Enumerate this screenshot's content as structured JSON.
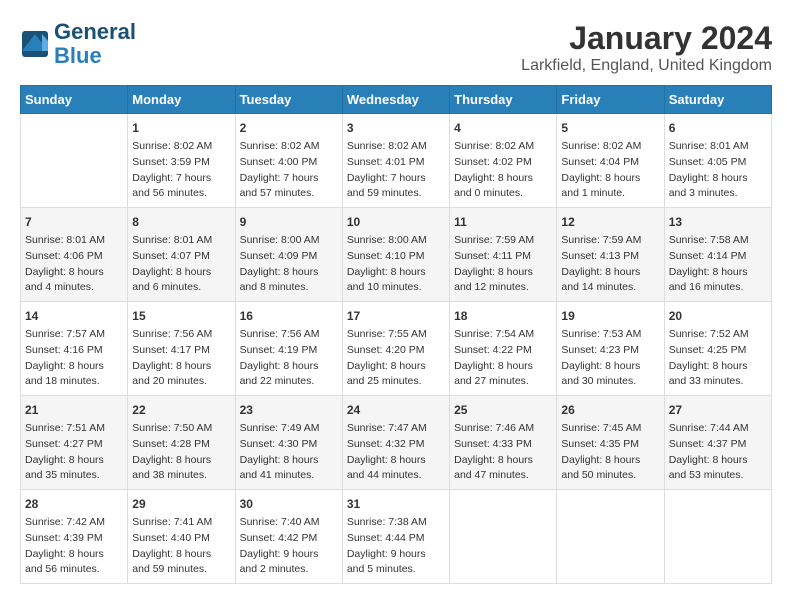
{
  "header": {
    "logo_line1": "General",
    "logo_line2": "Blue",
    "title": "January 2024",
    "subtitle": "Larkfield, England, United Kingdom"
  },
  "days_of_week": [
    "Sunday",
    "Monday",
    "Tuesday",
    "Wednesday",
    "Thursday",
    "Friday",
    "Saturday"
  ],
  "weeks": [
    [
      {
        "day": "",
        "content": ""
      },
      {
        "day": "1",
        "content": "Sunrise: 8:02 AM\nSunset: 3:59 PM\nDaylight: 7 hours\nand 56 minutes."
      },
      {
        "day": "2",
        "content": "Sunrise: 8:02 AM\nSunset: 4:00 PM\nDaylight: 7 hours\nand 57 minutes."
      },
      {
        "day": "3",
        "content": "Sunrise: 8:02 AM\nSunset: 4:01 PM\nDaylight: 7 hours\nand 59 minutes."
      },
      {
        "day": "4",
        "content": "Sunrise: 8:02 AM\nSunset: 4:02 PM\nDaylight: 8 hours\nand 0 minutes."
      },
      {
        "day": "5",
        "content": "Sunrise: 8:02 AM\nSunset: 4:04 PM\nDaylight: 8 hours\nand 1 minute."
      },
      {
        "day": "6",
        "content": "Sunrise: 8:01 AM\nSunset: 4:05 PM\nDaylight: 8 hours\nand 3 minutes."
      }
    ],
    [
      {
        "day": "7",
        "content": "Sunrise: 8:01 AM\nSunset: 4:06 PM\nDaylight: 8 hours\nand 4 minutes."
      },
      {
        "day": "8",
        "content": "Sunrise: 8:01 AM\nSunset: 4:07 PM\nDaylight: 8 hours\nand 6 minutes."
      },
      {
        "day": "9",
        "content": "Sunrise: 8:00 AM\nSunset: 4:09 PM\nDaylight: 8 hours\nand 8 minutes."
      },
      {
        "day": "10",
        "content": "Sunrise: 8:00 AM\nSunset: 4:10 PM\nDaylight: 8 hours\nand 10 minutes."
      },
      {
        "day": "11",
        "content": "Sunrise: 7:59 AM\nSunset: 4:11 PM\nDaylight: 8 hours\nand 12 minutes."
      },
      {
        "day": "12",
        "content": "Sunrise: 7:59 AM\nSunset: 4:13 PM\nDaylight: 8 hours\nand 14 minutes."
      },
      {
        "day": "13",
        "content": "Sunrise: 7:58 AM\nSunset: 4:14 PM\nDaylight: 8 hours\nand 16 minutes."
      }
    ],
    [
      {
        "day": "14",
        "content": "Sunrise: 7:57 AM\nSunset: 4:16 PM\nDaylight: 8 hours\nand 18 minutes."
      },
      {
        "day": "15",
        "content": "Sunrise: 7:56 AM\nSunset: 4:17 PM\nDaylight: 8 hours\nand 20 minutes."
      },
      {
        "day": "16",
        "content": "Sunrise: 7:56 AM\nSunset: 4:19 PM\nDaylight: 8 hours\nand 22 minutes."
      },
      {
        "day": "17",
        "content": "Sunrise: 7:55 AM\nSunset: 4:20 PM\nDaylight: 8 hours\nand 25 minutes."
      },
      {
        "day": "18",
        "content": "Sunrise: 7:54 AM\nSunset: 4:22 PM\nDaylight: 8 hours\nand 27 minutes."
      },
      {
        "day": "19",
        "content": "Sunrise: 7:53 AM\nSunset: 4:23 PM\nDaylight: 8 hours\nand 30 minutes."
      },
      {
        "day": "20",
        "content": "Sunrise: 7:52 AM\nSunset: 4:25 PM\nDaylight: 8 hours\nand 33 minutes."
      }
    ],
    [
      {
        "day": "21",
        "content": "Sunrise: 7:51 AM\nSunset: 4:27 PM\nDaylight: 8 hours\nand 35 minutes."
      },
      {
        "day": "22",
        "content": "Sunrise: 7:50 AM\nSunset: 4:28 PM\nDaylight: 8 hours\nand 38 minutes."
      },
      {
        "day": "23",
        "content": "Sunrise: 7:49 AM\nSunset: 4:30 PM\nDaylight: 8 hours\nand 41 minutes."
      },
      {
        "day": "24",
        "content": "Sunrise: 7:47 AM\nSunset: 4:32 PM\nDaylight: 8 hours\nand 44 minutes."
      },
      {
        "day": "25",
        "content": "Sunrise: 7:46 AM\nSunset: 4:33 PM\nDaylight: 8 hours\nand 47 minutes."
      },
      {
        "day": "26",
        "content": "Sunrise: 7:45 AM\nSunset: 4:35 PM\nDaylight: 8 hours\nand 50 minutes."
      },
      {
        "day": "27",
        "content": "Sunrise: 7:44 AM\nSunset: 4:37 PM\nDaylight: 8 hours\nand 53 minutes."
      }
    ],
    [
      {
        "day": "28",
        "content": "Sunrise: 7:42 AM\nSunset: 4:39 PM\nDaylight: 8 hours\nand 56 minutes."
      },
      {
        "day": "29",
        "content": "Sunrise: 7:41 AM\nSunset: 4:40 PM\nDaylight: 8 hours\nand 59 minutes."
      },
      {
        "day": "30",
        "content": "Sunrise: 7:40 AM\nSunset: 4:42 PM\nDaylight: 9 hours\nand 2 minutes."
      },
      {
        "day": "31",
        "content": "Sunrise: 7:38 AM\nSunset: 4:44 PM\nDaylight: 9 hours\nand 5 minutes."
      },
      {
        "day": "",
        "content": ""
      },
      {
        "day": "",
        "content": ""
      },
      {
        "day": "",
        "content": ""
      }
    ]
  ]
}
